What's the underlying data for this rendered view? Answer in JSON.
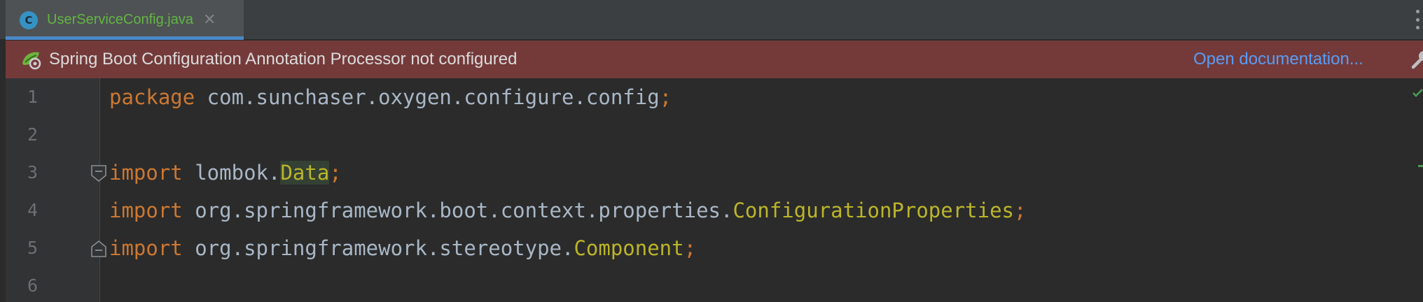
{
  "tab": {
    "icon_letter": "C",
    "label": "UserServiceConfig.java",
    "close_symbol": "✕"
  },
  "banner": {
    "message": "Spring Boot Configuration Annotation Processor not configured",
    "link": "Open documentation..."
  },
  "editor": {
    "lines": [
      {
        "num": "1",
        "kw": "package",
        "text": " com.sunchaser.oxygen.configure.config",
        "cls": "",
        "semi": ";"
      },
      {
        "num": "2",
        "kw": "",
        "text": "",
        "cls": "",
        "semi": ""
      },
      {
        "num": "3",
        "kw": "import",
        "text": " lombok.",
        "cls": "Data",
        "semi": ";"
      },
      {
        "num": "4",
        "kw": "import",
        "text": " org.springframework.boot.context.properties.",
        "cls": "ConfigurationProperties",
        "semi": ";"
      },
      {
        "num": "5",
        "kw": "import",
        "text": " org.springframework.stereotype.",
        "cls": "Component",
        "semi": ";"
      },
      {
        "num": "6",
        "kw": "",
        "text": "",
        "cls": "",
        "semi": ""
      }
    ]
  },
  "colors": {
    "keyword": "#cc7832",
    "class_ref": "#bbb529",
    "plain": "#a9b7c6",
    "banner_bg": "#743a3a",
    "link": "#589df6",
    "tab_label": "#62b543"
  },
  "icons": {
    "class": "java-class-icon",
    "close": "close-icon",
    "spring": "spring-boot-icon",
    "wrench": "wrench-icon",
    "fold": "fold-marker-icon",
    "check": "check-icon"
  }
}
